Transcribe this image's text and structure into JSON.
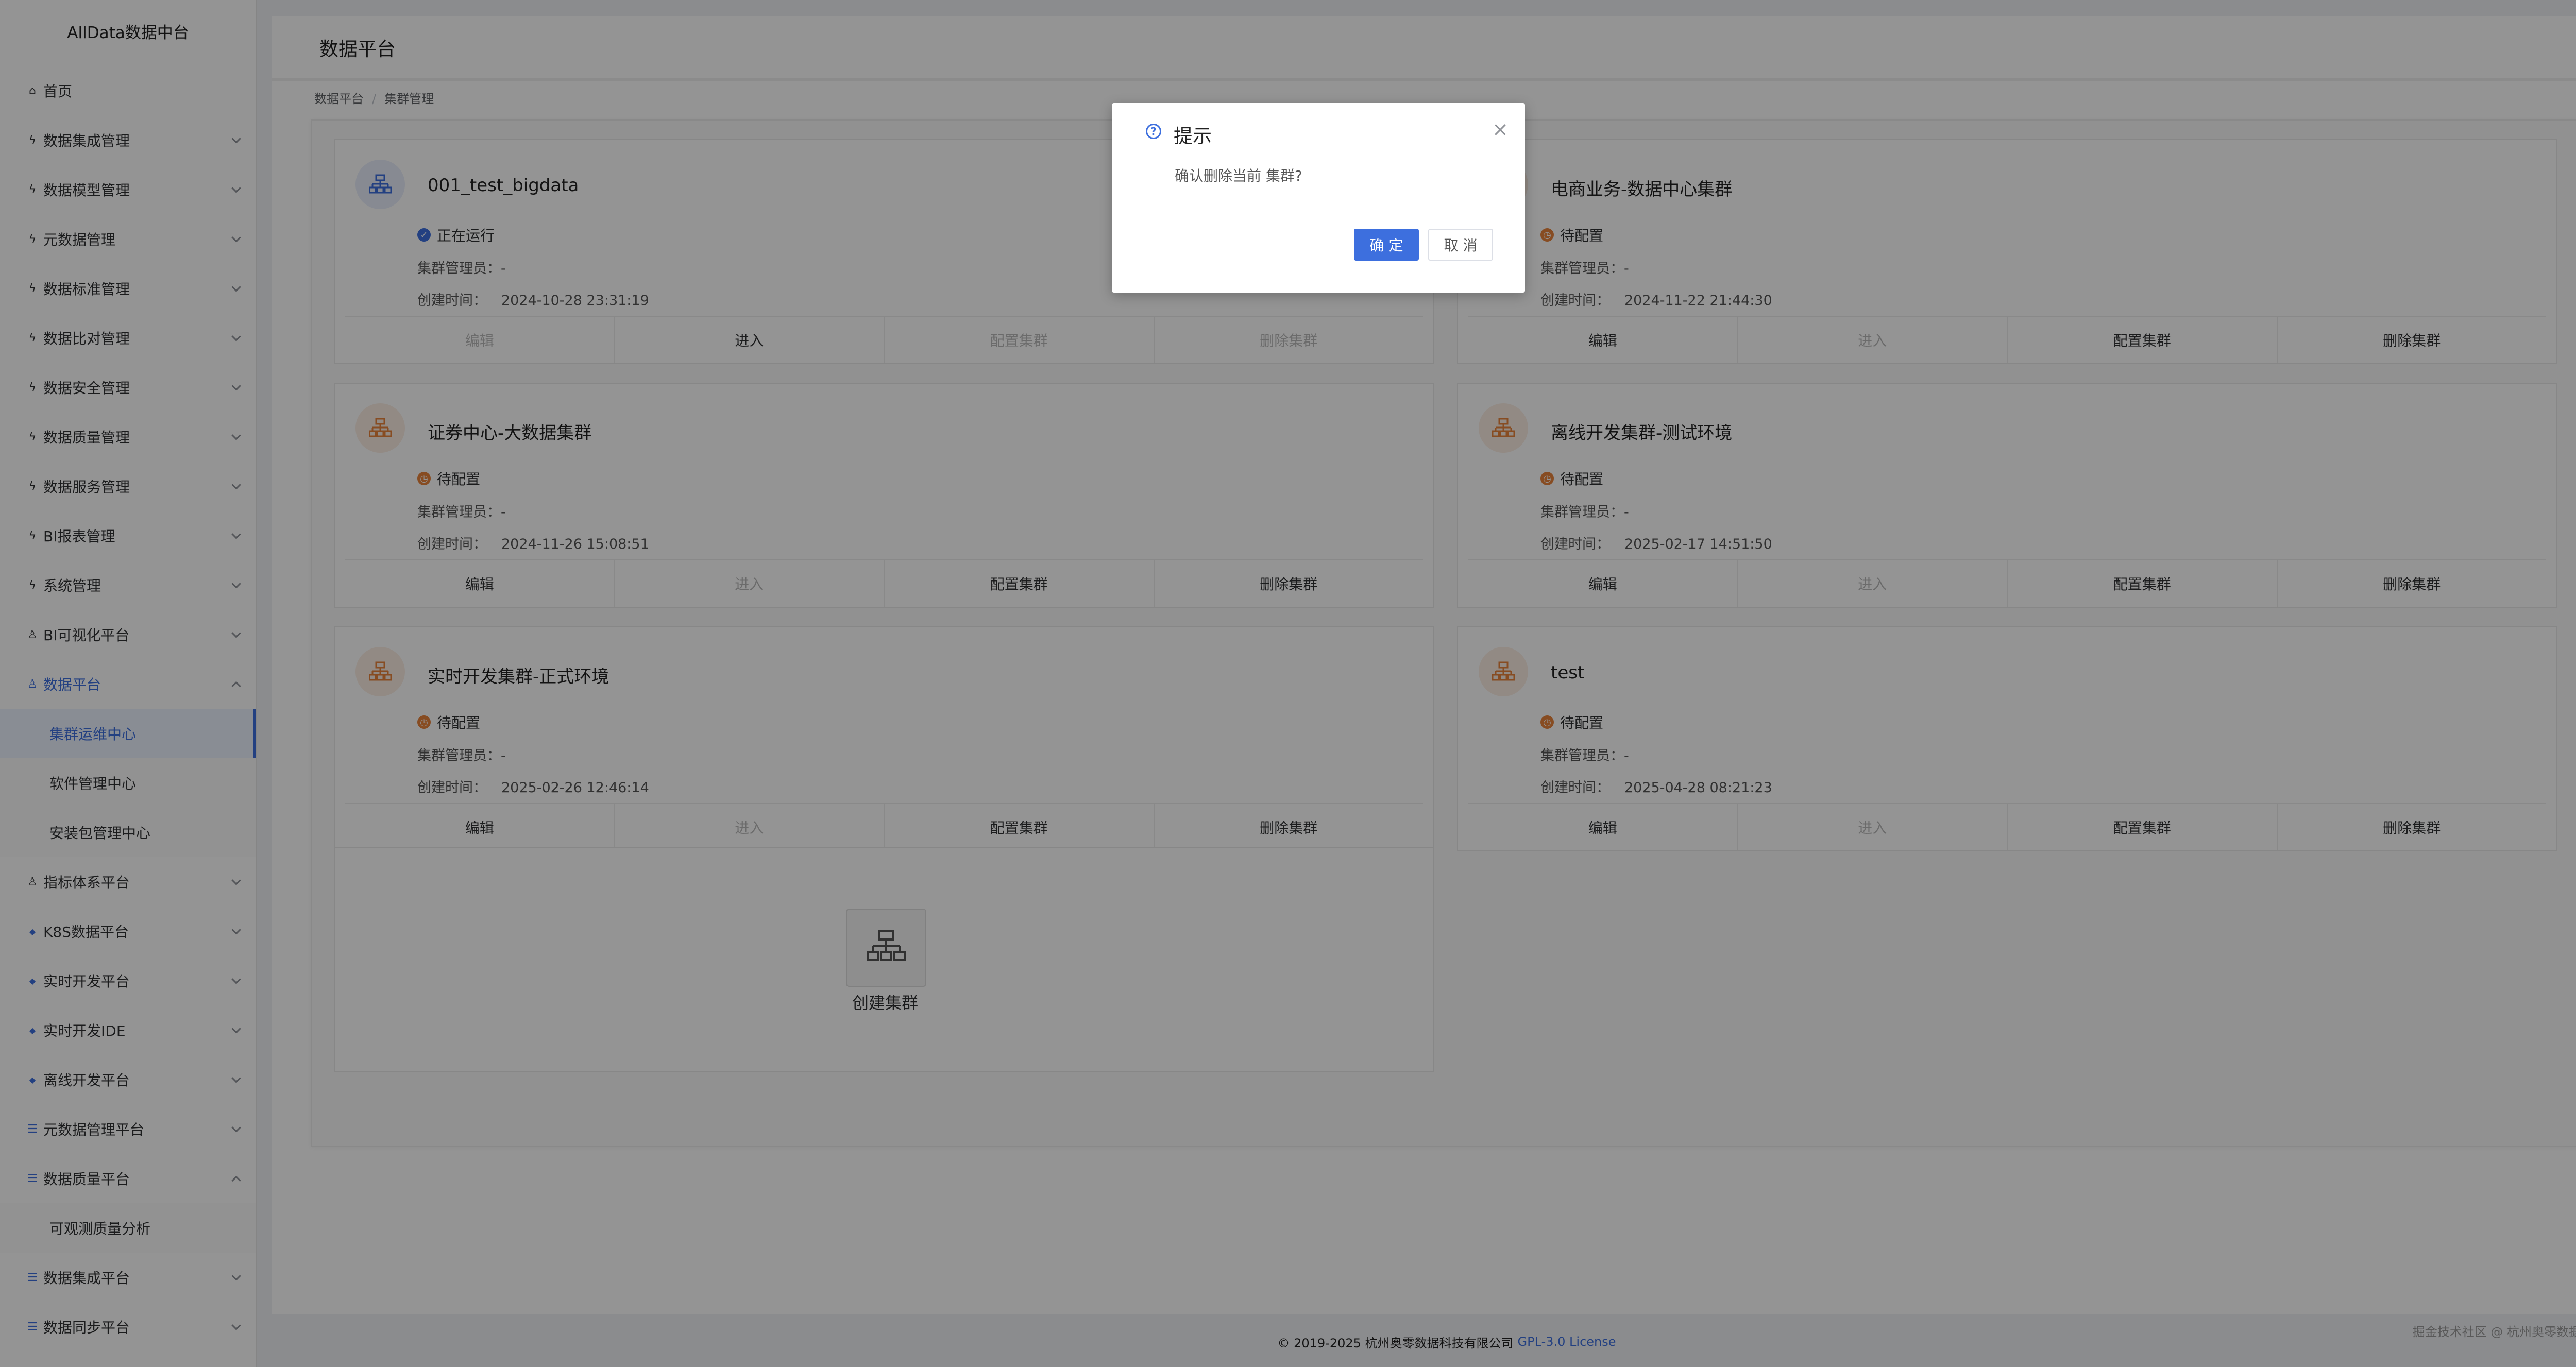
{
  "app": {
    "logo_title": "AllData数据中台"
  },
  "sidebar": {
    "items": [
      {
        "label": "首页",
        "icon": "home-icon",
        "glyph": "⌂"
      },
      {
        "label": "数据集成管理",
        "icon": "bolt-icon",
        "glyph": "ϟ"
      },
      {
        "label": "数据模型管理",
        "icon": "bolt-icon",
        "glyph": "ϟ"
      },
      {
        "label": "元数据管理",
        "icon": "bolt-icon",
        "glyph": "ϟ"
      },
      {
        "label": "数据标准管理",
        "icon": "bolt-icon",
        "glyph": "ϟ"
      },
      {
        "label": "数据比对管理",
        "icon": "bolt-icon",
        "glyph": "ϟ"
      },
      {
        "label": "数据安全管理",
        "icon": "bolt-icon",
        "glyph": "ϟ"
      },
      {
        "label": "数据质量管理",
        "icon": "bolt-icon",
        "glyph": "ϟ"
      },
      {
        "label": "数据服务管理",
        "icon": "bolt-icon",
        "glyph": "ϟ"
      },
      {
        "label": "BI报表管理",
        "icon": "bolt-icon",
        "glyph": "ϟ"
      },
      {
        "label": "系统管理",
        "icon": "bolt-icon",
        "glyph": "ϟ"
      },
      {
        "label": "BI可视化平台",
        "icon": "person-icon",
        "glyph": "♙"
      },
      {
        "label": "数据平台",
        "icon": "person-icon",
        "glyph": "♙"
      },
      {
        "label": "集群运维中心"
      },
      {
        "label": "软件管理中心"
      },
      {
        "label": "安装包管理中心"
      },
      {
        "label": "指标体系平台",
        "icon": "person-icon",
        "glyph": "♙"
      },
      {
        "label": "K8S数据平台",
        "icon": "diamond-icon",
        "glyph": "◆"
      },
      {
        "label": "实时开发平台",
        "icon": "diamond-icon",
        "glyph": "◆"
      },
      {
        "label": "实时开发IDE",
        "icon": "diamond-icon",
        "glyph": "◆"
      },
      {
        "label": "离线开发平台",
        "icon": "diamond-icon",
        "glyph": "◆"
      },
      {
        "label": "元数据管理平台",
        "icon": "layers-icon",
        "glyph": "☰"
      },
      {
        "label": "数据质量平台",
        "icon": "layers-icon",
        "glyph": "☰"
      },
      {
        "label": "可观测质量分析"
      },
      {
        "label": "数据集成平台",
        "icon": "layers-icon",
        "glyph": "☰"
      },
      {
        "label": "数据同步平台",
        "icon": "layers-icon",
        "glyph": "☰"
      }
    ]
  },
  "page": {
    "title": "数据平台",
    "breadcrumb": [
      "数据平台",
      "集群管理"
    ]
  },
  "labels": {
    "admin": "集群管理员：",
    "created": "创建时间："
  },
  "clusters": [
    {
      "name": "001_test_bigdata",
      "status": "正在运行",
      "admin": "-",
      "created": "2024-10-28 23:31:19",
      "actions": [
        "编辑",
        "进入",
        "配置集群",
        "删除集群"
      ]
    },
    {
      "name": "电商业务-数据中心集群",
      "status": "待配置",
      "admin": "-",
      "created": "2024-11-22 21:44:30",
      "actions": [
        "编辑",
        "进入",
        "配置集群",
        "删除集群"
      ]
    },
    {
      "name": "证券中心-大数据集群",
      "status": "待配置",
      "admin": "-",
      "created": "2024-11-26 15:08:51",
      "actions": [
        "编辑",
        "进入",
        "配置集群",
        "删除集群"
      ]
    },
    {
      "name": "离线开发集群-测试环境",
      "status": "待配置",
      "admin": "-",
      "created": "2025-02-17 14:51:50",
      "actions": [
        "编辑",
        "进入",
        "配置集群",
        "删除集群"
      ]
    },
    {
      "name": "实时开发集群-正式环境",
      "status": "待配置",
      "admin": "-",
      "created": "2025-02-26 12:46:14",
      "actions": [
        "编辑",
        "进入",
        "配置集群",
        "删除集群"
      ]
    },
    {
      "name": "test",
      "status": "待配置",
      "admin": "-",
      "created": "2025-04-28 08:21:23",
      "actions": [
        "编辑",
        "进入",
        "配置集群",
        "删除集群"
      ]
    }
  ],
  "create": {
    "label": "创建集群"
  },
  "footer": {
    "copyright": "© 2019-2025 杭州奥零数据科技有限公司",
    "license": "GPL-3.0 License",
    "watermark": "掘金技术社区 @ 杭州奥零数据科技"
  },
  "dialog": {
    "title": "提示",
    "message": "确认删除当前 集群?",
    "ok": "确 定",
    "cancel": "取 消",
    "close_glyph": "×"
  },
  "colors": {
    "accent": "#3d6fde",
    "pending": "#e8843c"
  }
}
